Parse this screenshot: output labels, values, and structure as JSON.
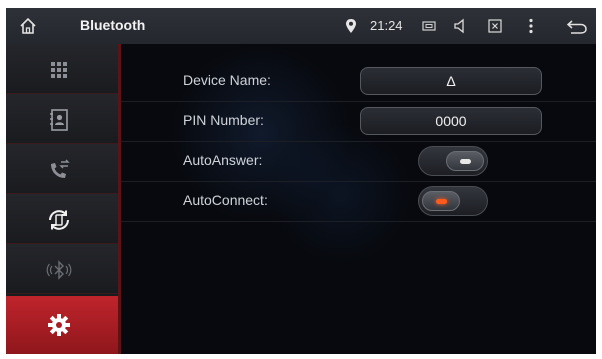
{
  "statusbar": {
    "title": "Bluetooth",
    "time": "21:24",
    "icons": [
      "home-icon",
      "location-pin-icon",
      "screenshot-icon",
      "volume-icon",
      "close-window-icon",
      "more-vert-icon",
      "back-icon"
    ]
  },
  "sidebar": {
    "items": [
      {
        "name": "dialpad",
        "icon": "dialpad-icon",
        "active": false
      },
      {
        "name": "contacts",
        "icon": "contacts-icon",
        "active": false
      },
      {
        "name": "call-log",
        "icon": "call-transfer-icon",
        "active": false
      },
      {
        "name": "music",
        "icon": "phone-sync-icon",
        "active": false
      },
      {
        "name": "bluetooth",
        "icon": "bluetooth-icon",
        "active": false
      },
      {
        "name": "settings",
        "icon": "gear-icon",
        "active": true
      }
    ]
  },
  "settings": {
    "device_name_label": "Device Name:",
    "device_name_value": "Δ",
    "pin_label": "PIN Number:",
    "pin_value": "0000",
    "autoanswer_label": "AutoAnswer:",
    "autoanswer_on": false,
    "autoconnect_label": "AutoConnect:",
    "autoconnect_on": true
  },
  "colors": {
    "accent": "#c0242b",
    "led_on": "#ff5a1e",
    "led_off": "#e8e8e8"
  }
}
